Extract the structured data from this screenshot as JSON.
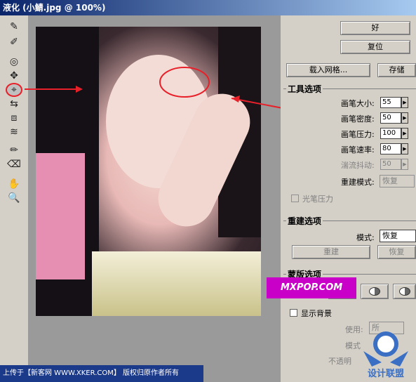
{
  "window": {
    "title": "液化 (小鯖.jpg @ 100%)"
  },
  "tools": [
    {
      "icon": "forward-warp-icon",
      "glyph": "✎"
    },
    {
      "icon": "reconstruct-icon",
      "glyph": "✐"
    },
    {
      "icon": "twirl-icon",
      "glyph": "◎"
    },
    {
      "icon": "pucker-icon",
      "glyph": "✥"
    },
    {
      "icon": "bloat-icon",
      "glyph": "⌖"
    },
    {
      "icon": "push-left-icon",
      "glyph": "⇆"
    },
    {
      "icon": "mirror-icon",
      "glyph": "⧈"
    },
    {
      "icon": "turbulence-icon",
      "glyph": "≋"
    },
    {
      "icon": "freeze-mask-icon",
      "glyph": "✏"
    },
    {
      "icon": "thaw-mask-icon",
      "glyph": "⌫"
    },
    {
      "icon": "hand-icon",
      "glyph": "✋"
    },
    {
      "icon": "zoom-icon",
      "glyph": "🔍"
    }
  ],
  "buttons": {
    "ok": "好",
    "reset": "复位",
    "load_mesh": "载入网格...",
    "save": "存储"
  },
  "tool_options": {
    "title": "工具选项",
    "brush_size_label": "画笔大小:",
    "brush_size": "55",
    "brush_density_label": "画笔密度:",
    "brush_density": "50",
    "brush_pressure_label": "画笔压力:",
    "brush_pressure": "100",
    "brush_rate_label": "画笔速率:",
    "brush_rate": "80",
    "turbulent_jitter_label": "湍流抖动:",
    "turbulent_jitter": "50",
    "reconstruct_mode_label": "重建模式:",
    "reconstruct_mode": "恢复",
    "stylus_pressure_label": "光笔压力"
  },
  "reconstruct_options": {
    "title": "重建选项",
    "mode_label": "模式:",
    "mode": "恢复",
    "reconstruct_button": "重建",
    "restore_button": "恢复"
  },
  "mask_options": {
    "title": "蒙版选项"
  },
  "view_options": {
    "show_backdrop_label": "显示背景",
    "use_label": "使用:",
    "use_value": "所",
    "mode_label": "模式",
    "opacity_label": "不透明"
  },
  "watermark": {
    "mx_text": "MXPOP.COM",
    "site_cn": "设计联盟"
  },
  "footer": {
    "credit": "上传于【新客网 WWW.XKER.COM】 版权归原作者所有"
  },
  "colors": {
    "annotation_red": "#e8202a",
    "title_bar": "#0a246a",
    "watermark_magenta": "#c800c8"
  }
}
